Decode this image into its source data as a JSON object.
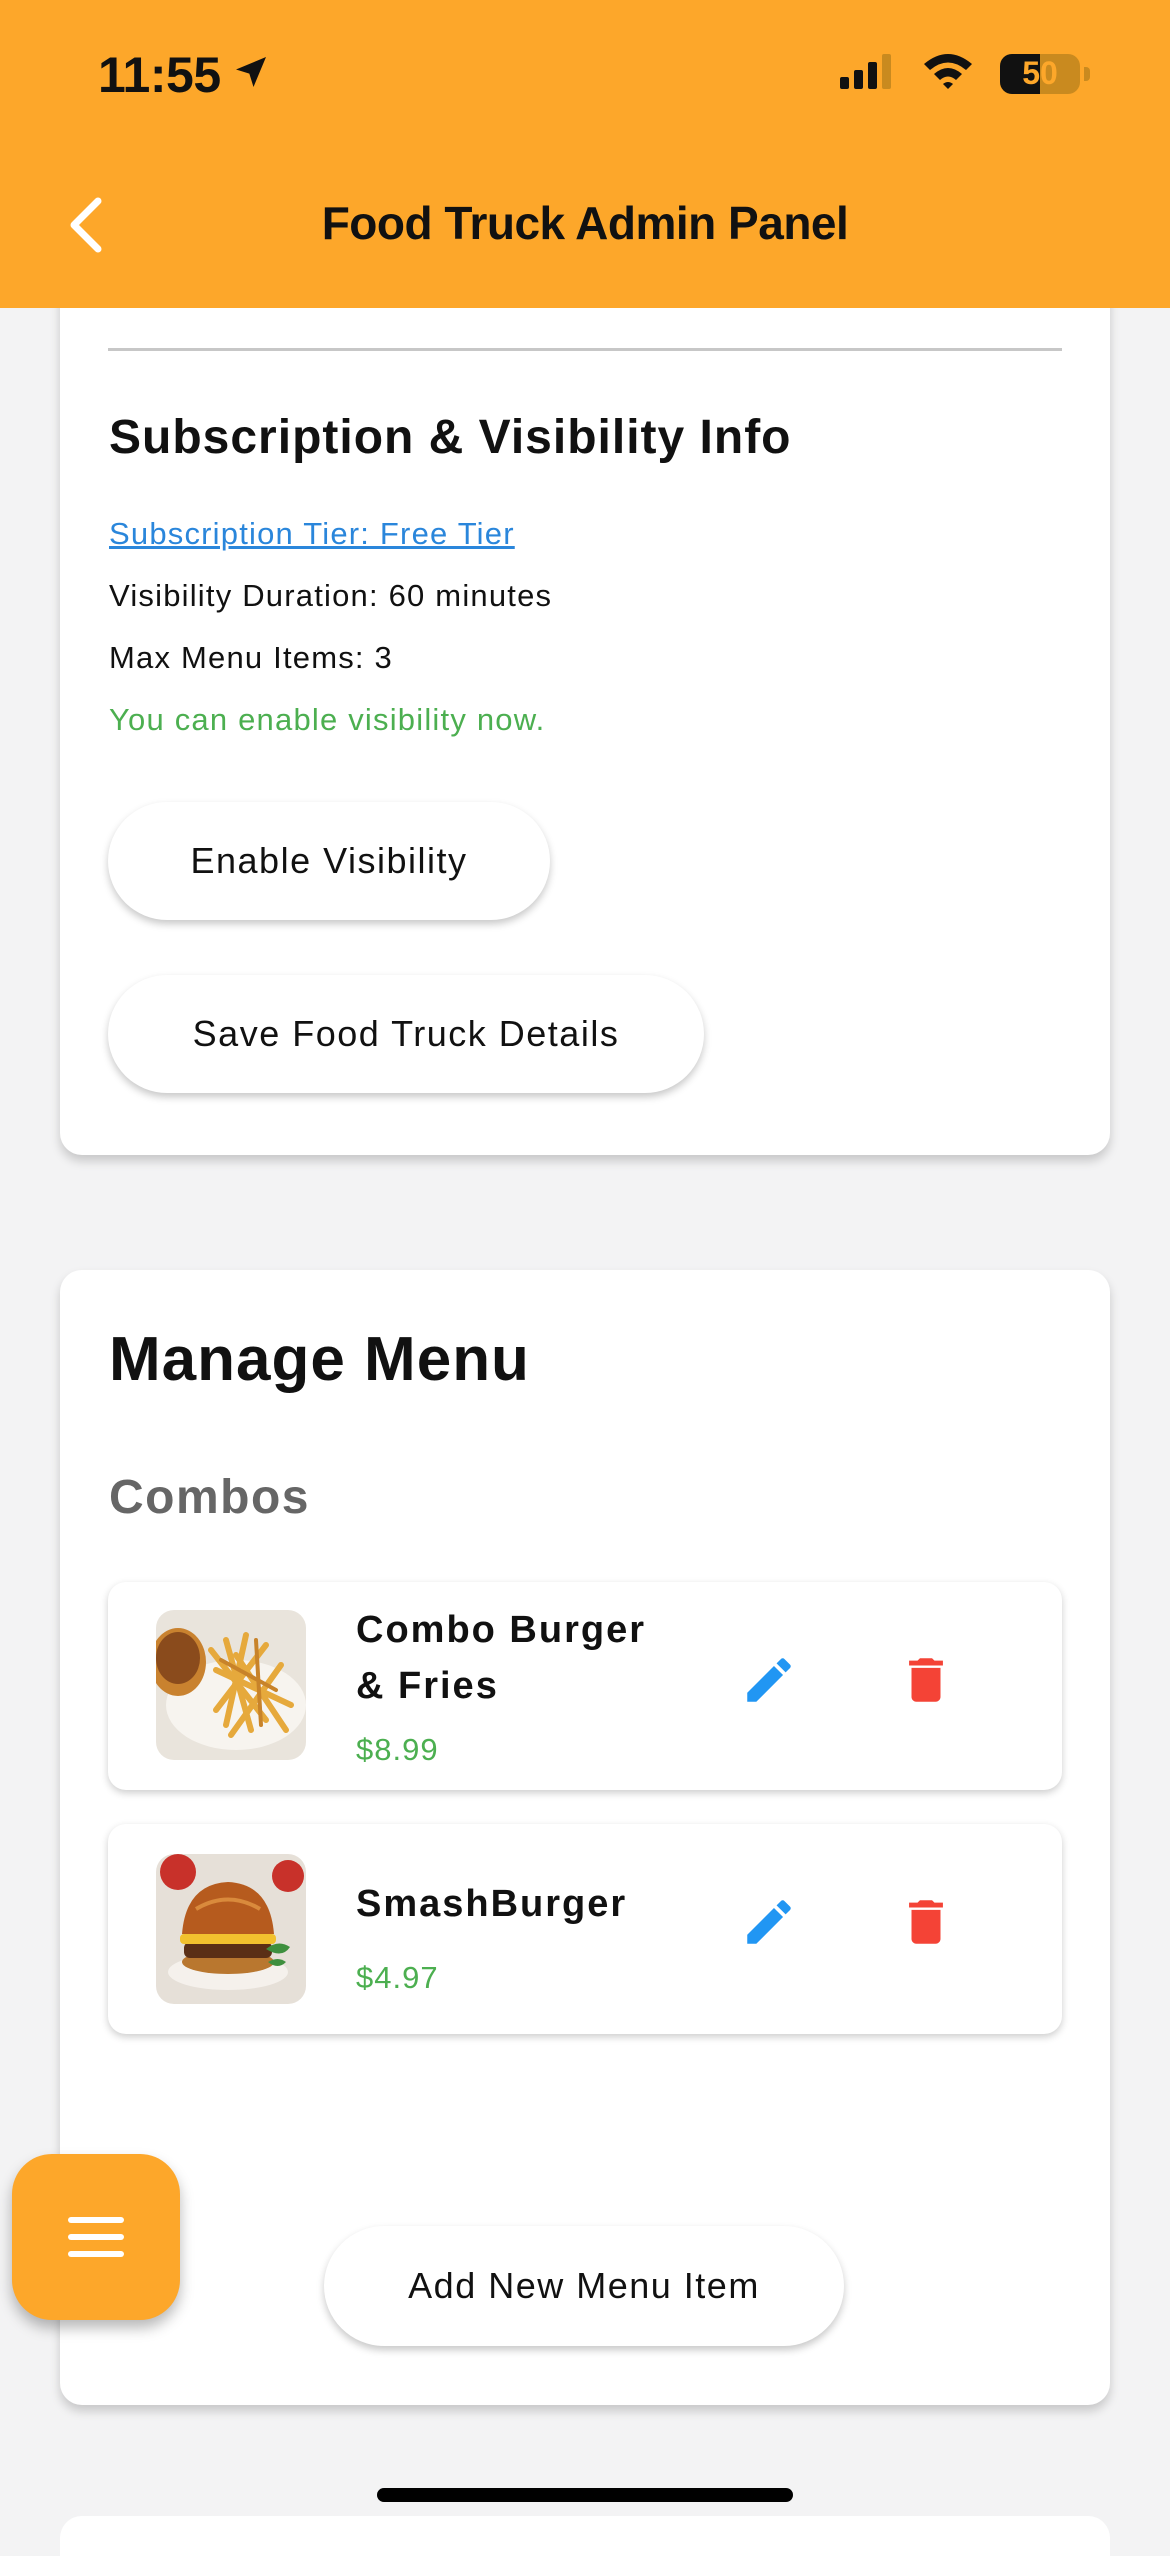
{
  "status_bar": {
    "time": "11:55",
    "battery": "50",
    "battery_level_percent": 50
  },
  "header": {
    "title": "Food Truck Admin Panel",
    "back_icon": "chevron-left-icon",
    "background_color": "#FDA72A"
  },
  "subscription": {
    "title": "Subscription & Visibility Info",
    "tier_link": "Subscription Tier: Free Tier",
    "visibility_duration": "Visibility Duration: 60 minutes",
    "max_menu_items": "Max Menu Items: 3",
    "status_message": "You can enable visibility now.",
    "enable_button": "Enable Visibility",
    "save_button": "Save Food Truck Details"
  },
  "menu": {
    "title": "Manage Menu",
    "category": "Combos",
    "items": [
      {
        "name_line1": "Combo Burger",
        "name_line2": "& Fries",
        "price": "$8.99"
      },
      {
        "name_line1": "SmashBurger",
        "price": "$4.97"
      }
    ],
    "add_button": "Add New Menu Item"
  },
  "colors": {
    "accent": "#FDA72A",
    "link": "#2A86DB",
    "success": "#4CAF50",
    "edit": "#2196F3",
    "delete": "#F44336"
  }
}
